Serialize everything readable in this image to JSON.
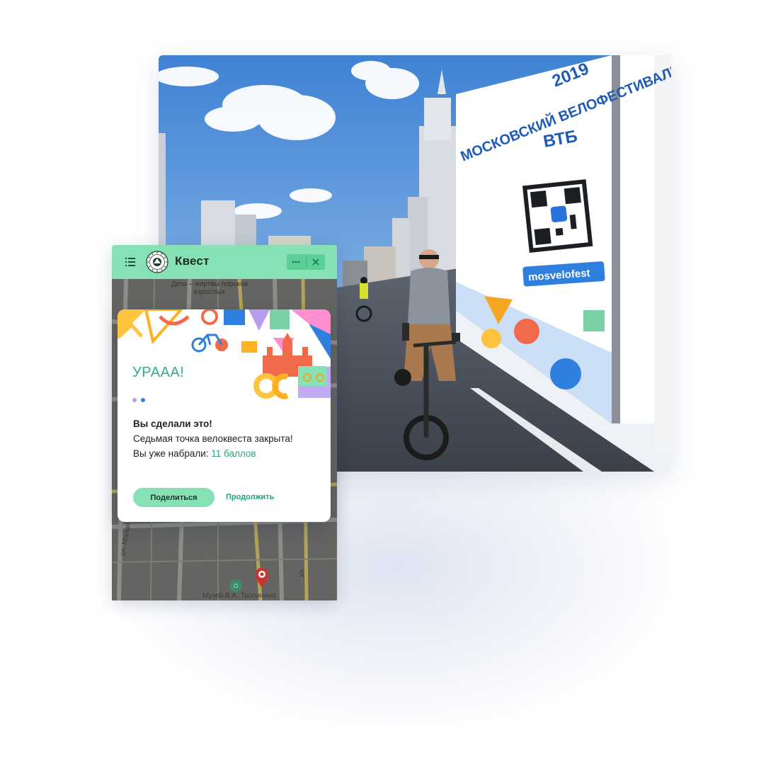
{
  "widget": {
    "title": "Квест",
    "menu_icon": "list-icon",
    "logo_icon": "moscow-seal-logo",
    "more_icon": "more-dots-icon",
    "close_icon": "close-icon"
  },
  "map": {
    "poi_top": "Дети – жертвы пороков взрослых",
    "street_left": "ул. Малая Полянка",
    "street_right": "ул.",
    "museum": "Музей В.А. Тропинина"
  },
  "card": {
    "title": "УРААА!",
    "line1": "Вы сделали это!",
    "line2": "Седьмая точка велоквеста закрыта!",
    "line3_prefix": "Вы уже набрали: ",
    "line3_points": "11 баллов",
    "share_label": "Поделиться",
    "continue_label": "Продолжить"
  },
  "photo": {
    "banner_heading": "МОСКОВСКИЙ ВЕЛОФЕСТИВАЛЬ",
    "banner_year": "2019",
    "sponsor": "ВТБ",
    "hashtag": "mosvelofest"
  },
  "colors": {
    "accent_green": "#86e2b5",
    "accent_dark": "#2fae84",
    "dot_purple": "#b79cf0",
    "dot_blue": "#3f7ae0"
  }
}
